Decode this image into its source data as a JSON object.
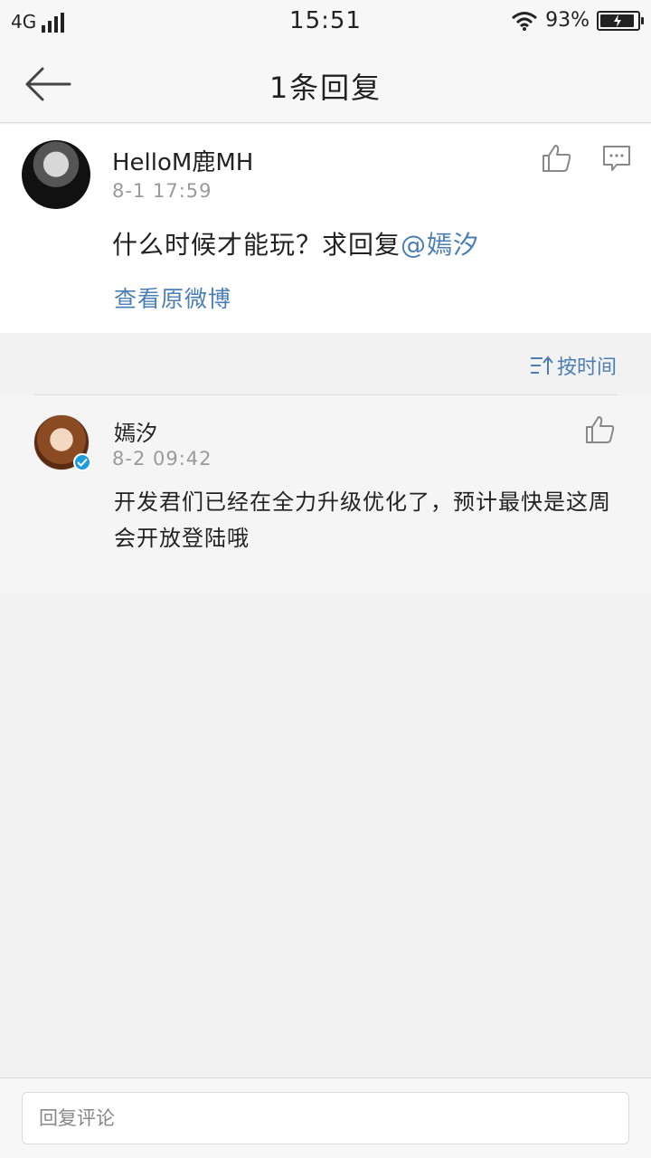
{
  "status_bar": {
    "network": "4G",
    "time": "15:51",
    "battery_text": "93%",
    "battery_level": 0.93
  },
  "nav": {
    "title": "1条回复"
  },
  "original_comment": {
    "username": "HelloM鹿MH",
    "timestamp": "8-1 17:59",
    "text": "什么时候才能玩？求回复",
    "mention": "@嫣汐",
    "view_original_label": "查看原微博"
  },
  "sort": {
    "label": "按时间"
  },
  "reply": {
    "username": "嫣汐",
    "timestamp": "8-2 09:42",
    "text": "开发君们已经在全力升级优化了，预计最快是这周会开放登陆哦",
    "verified": true
  },
  "reply_bar": {
    "placeholder": "回复评论"
  },
  "colors": {
    "link": "#4a7fb5",
    "verified_badge": "#1b9be0",
    "background": "#f2f2f2"
  }
}
